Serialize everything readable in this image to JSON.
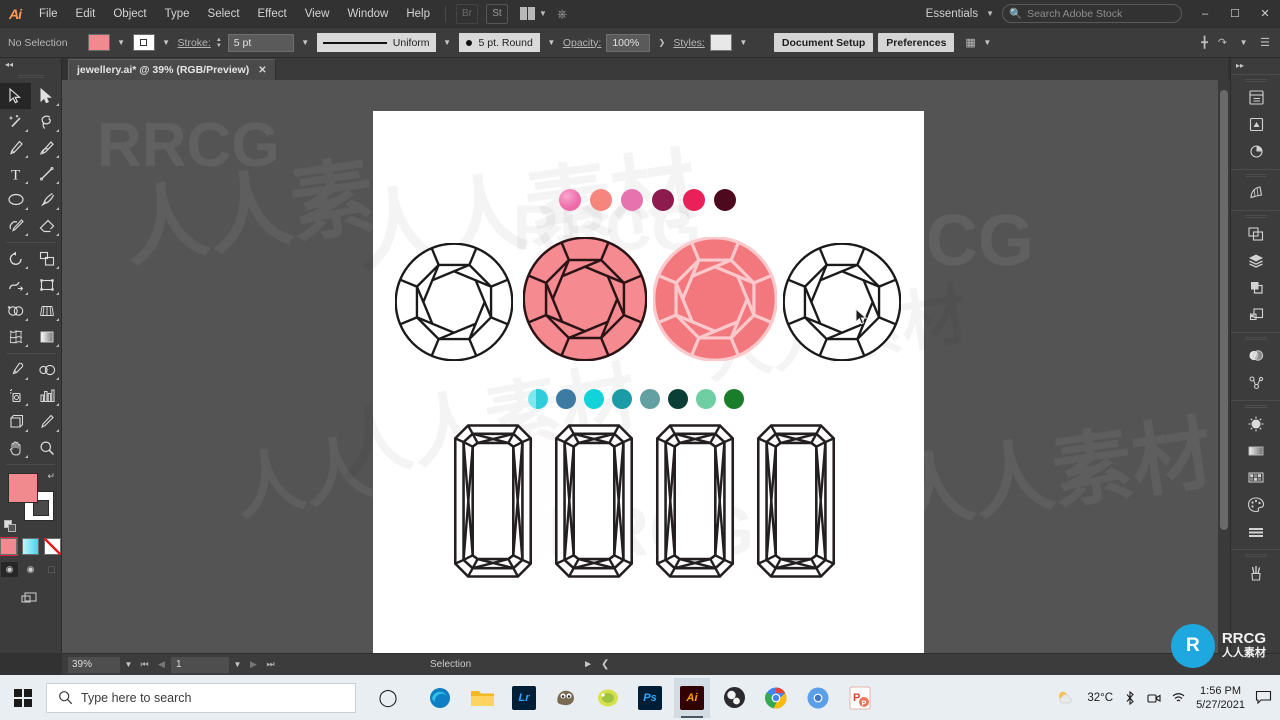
{
  "app": {
    "name": "Adobe Illustrator",
    "logo_text": "Ai",
    "accent_color": "#ff9a5c"
  },
  "menubar": {
    "items": [
      "File",
      "Edit",
      "Object",
      "Type",
      "Select",
      "Effect",
      "View",
      "Window",
      "Help"
    ],
    "bridge_label": "Br",
    "stock_label": "St",
    "workspace": "Essentials",
    "search_placeholder": "Search Adobe Stock",
    "window_controls": {
      "minimize": "–",
      "maximize": "☐",
      "close": "✕"
    }
  },
  "controlbar": {
    "selection_state": "No Selection",
    "fill_color": "#f08a8f",
    "stroke_color": "#ffffff",
    "stroke_label": "Stroke:",
    "stroke_weight": "5 pt",
    "profile_label": "Uniform",
    "cap_label": "5 pt. Round",
    "opacity_label": "Opacity:",
    "opacity_value": "100%",
    "styles_label": "Styles:",
    "document_setup": "Document Setup",
    "preferences": "Preferences"
  },
  "document": {
    "tab_title": "jewellery.ai* @ 39% (RGB/Preview)",
    "close_glyph": "✕"
  },
  "toolbar": {
    "collapse_glyph": "◂◂",
    "tools": [
      {
        "name": "selection-tool",
        "active": true
      },
      {
        "name": "direct-selection-tool",
        "active": false
      },
      {
        "name": "magic-wand-tool",
        "active": false
      },
      {
        "name": "lasso-tool",
        "active": false
      },
      {
        "name": "pen-tool",
        "active": false
      },
      {
        "name": "curvature-tool",
        "active": false
      },
      {
        "name": "type-tool",
        "active": false
      },
      {
        "name": "line-segment-tool",
        "active": false
      },
      {
        "name": "ellipse-tool",
        "active": false
      },
      {
        "name": "paintbrush-tool",
        "active": false
      },
      {
        "name": "shaper-tool",
        "active": false
      },
      {
        "name": "eraser-tool",
        "active": false
      },
      {
        "name": "rotate-tool",
        "active": false
      },
      {
        "name": "scale-tool",
        "active": false
      },
      {
        "name": "width-tool",
        "active": false
      },
      {
        "name": "free-transform-tool",
        "active": false
      },
      {
        "name": "shape-builder-tool",
        "active": false
      },
      {
        "name": "perspective-grid-tool",
        "active": false
      },
      {
        "name": "mesh-tool",
        "active": false
      },
      {
        "name": "gradient-tool",
        "active": false
      },
      {
        "name": "eyedropper-tool",
        "active": false
      },
      {
        "name": "blend-tool",
        "active": false
      },
      {
        "name": "symbol-sprayer-tool",
        "active": false
      },
      {
        "name": "column-graph-tool",
        "active": false
      },
      {
        "name": "artboard-tool",
        "active": false
      },
      {
        "name": "slice-tool",
        "active": false
      },
      {
        "name": "hand-tool",
        "active": false
      },
      {
        "name": "zoom-tool",
        "active": false
      }
    ],
    "fill_color": "#f08a8f",
    "stroke_color": "#ffffff",
    "color_modes": [
      "color",
      "gradient",
      "none"
    ],
    "screen_modes": [
      "normal-screen-mode",
      "full-screen-menu-mode",
      "full-screen-mode"
    ]
  },
  "canvas": {
    "background": "#545454",
    "artboard_color": "#ffffff",
    "pink_swatches": {
      "label": "pink-palette",
      "colors": [
        "#ef6aa8",
        "#f6857e",
        "#e673ae",
        "#8e1b4e",
        "#e9205a",
        "#4d0a1e"
      ]
    },
    "teal_swatches": {
      "label": "teal-palette",
      "colors": [
        "#3ed6e0",
        "#3d7ba3",
        "#13d3da",
        "#1a9ba6",
        "#63a0a2",
        "#0b3f35",
        "#6fcfa2",
        "#197d2a"
      ]
    },
    "round_gems": [
      {
        "name": "round-gem-outline",
        "fill": "#ffffff",
        "stroke": "#1a1a1a"
      },
      {
        "name": "round-gem-pink-dark-stroke",
        "fill": "#f58a90",
        "stroke": "#2b1416"
      },
      {
        "name": "round-gem-pink-light-stroke",
        "fill": "#f2787e",
        "stroke": "#fbc9cc"
      },
      {
        "name": "round-gem-outline-2",
        "fill": "#ffffff",
        "stroke": "#1a1a1a"
      }
    ],
    "emerald_gems": [
      {
        "name": "emerald-gem-1",
        "fill": "#ffffff",
        "stroke": "#231f20"
      },
      {
        "name": "emerald-gem-2",
        "fill": "#ffffff",
        "stroke": "#231f20"
      },
      {
        "name": "emerald-gem-3",
        "fill": "#ffffff",
        "stroke": "#231f20"
      },
      {
        "name": "emerald-gem-4",
        "fill": "#ffffff",
        "stroke": "#231f20"
      }
    ]
  },
  "rightpanel": {
    "collapse_glyph": "▸▸",
    "items": [
      "properties-panel-icon",
      "libraries-panel-icon",
      "brushes-panel-icon",
      "symbols-panel-icon",
      "artboards-panel-icon",
      "layers-panel-icon",
      "pathfinder-panel-icon",
      "align-panel-icon",
      "transparency-panel-icon",
      "appearance-panel-icon",
      "stroke-panel-icon",
      "gradient-panel-icon",
      "swatches-panel-icon",
      "color-panel-icon",
      "align-rows-panel-icon",
      "brush-libraries-panel-icon"
    ]
  },
  "statusbar": {
    "zoom": "39%",
    "page": "1",
    "status_text": "Selection",
    "first_glyph": "⏮",
    "prev_glyph": "◀",
    "next_glyph": "▶",
    "last_glyph": "⏭"
  },
  "taskbar": {
    "search_placeholder": "Type here to search",
    "cortana_glyph": "◯",
    "apps": [
      {
        "name": "taskbar-edge",
        "label": "e",
        "bg": "#0f6cbd",
        "fg": "#ffffff",
        "active": false
      },
      {
        "name": "taskbar-file-explorer",
        "label": "",
        "bg": "#ffc107",
        "fg": "#8a6d00",
        "active": false
      },
      {
        "name": "taskbar-lightroom",
        "label": "Lr",
        "bg": "#001e36",
        "fg": "#31a8ff",
        "active": false
      },
      {
        "name": "taskbar-gimp",
        "label": "",
        "bg": "transparent",
        "fg": "#6b5b45",
        "active": false
      },
      {
        "name": "taskbar-paint",
        "label": "",
        "bg": "transparent",
        "fg": "#c8cf3a",
        "active": false
      },
      {
        "name": "taskbar-photoshop",
        "label": "Ps",
        "bg": "#001e36",
        "fg": "#31a8ff",
        "active": false
      },
      {
        "name": "taskbar-illustrator",
        "label": "Ai",
        "bg": "#310000",
        "fg": "#ff9a00",
        "active": true
      },
      {
        "name": "taskbar-obs",
        "label": "",
        "bg": "#302e31",
        "fg": "#ffffff",
        "active": false
      },
      {
        "name": "taskbar-chrome",
        "label": "",
        "bg": "transparent",
        "fg": "#4285f4",
        "active": false
      },
      {
        "name": "taskbar-chrome-canary",
        "label": "",
        "bg": "transparent",
        "fg": "#4f9fe8",
        "active": false
      },
      {
        "name": "taskbar-powerpoint",
        "label": "P",
        "bg": "#ffffff",
        "fg": "#d24726",
        "active": false
      }
    ],
    "tray": {
      "weather_temp": "32°C",
      "time": "1:56 PM",
      "date": "5/27/2021",
      "notification_glyph": "▭"
    }
  },
  "watermarks": {
    "primary": "RRCG",
    "secondary": "人人素材",
    "badge_text_top": "RRCG",
    "badge_text_bottom": "人人素材",
    "badge_glyph": "R"
  }
}
